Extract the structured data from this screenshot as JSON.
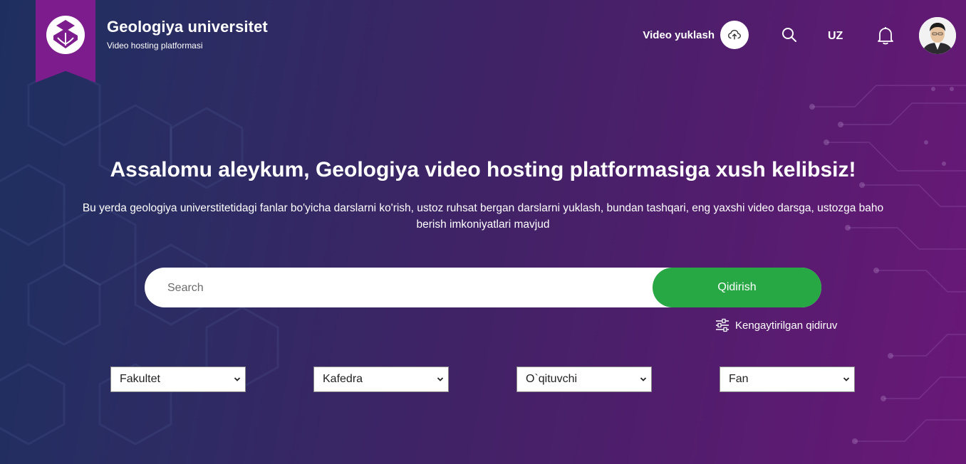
{
  "header": {
    "brand_title": "Geologiya universitet",
    "brand_subtitle": "Video hosting platformasi",
    "upload_label": "Video yuklash",
    "language": "UZ"
  },
  "icons": {
    "logo": "university-logo-icon",
    "upload": "cloud-upload-icon",
    "search": "search-icon",
    "notifications": "bell-icon",
    "avatar": "user-avatar",
    "advanced_search": "sliders-icon",
    "dropdown": "chevron-down-icon"
  },
  "hero": {
    "title": "Assalomu aleykum, Geologiya video hosting platformasiga xush kelibsiz!",
    "description": "Bu yerda geologiya universtitetidagi fanlar bo'yicha darslarni ko'rish, ustoz ruhsat bergan darslarni yuklash, bundan tashqari, eng yaxshi video darsga, ustozga baho berish imkoniyatlari mavjud"
  },
  "search": {
    "placeholder": "Search",
    "value": "",
    "button_label": "Qidirish",
    "advanced_label": "Kengaytirilgan qidiruv"
  },
  "filters": [
    {
      "label": "Fakultet"
    },
    {
      "label": "Kafedra"
    },
    {
      "label": "O`qituvchi"
    },
    {
      "label": "Fan"
    }
  ],
  "colors": {
    "ribbon": "#7d1c8c",
    "search_button": "#28a745",
    "bg_left": "#1e2f5f",
    "bg_right": "#6a1878"
  }
}
